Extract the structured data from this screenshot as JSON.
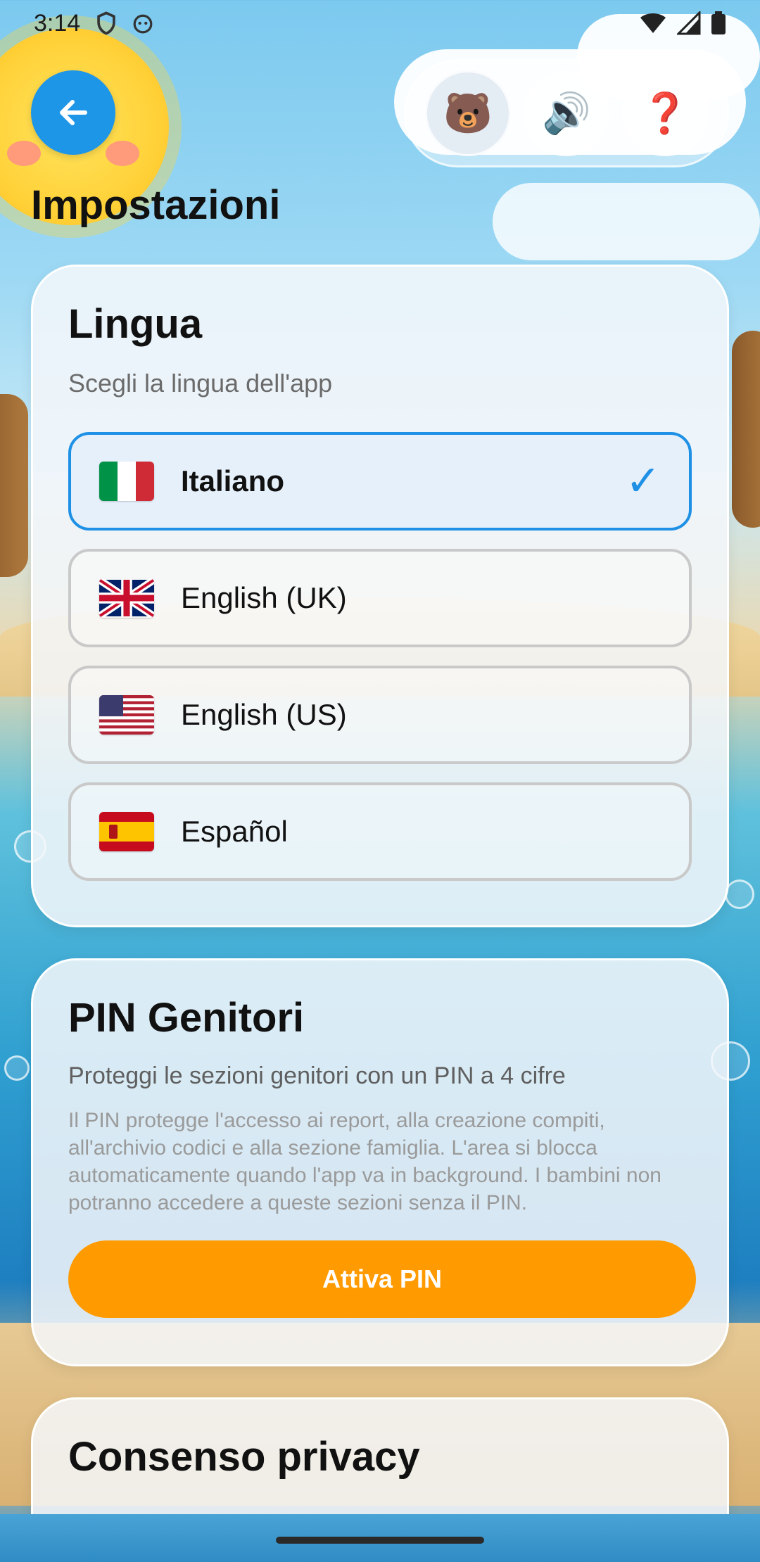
{
  "status_bar": {
    "time": "3:14"
  },
  "header": {
    "back_icon": "arrow-left-icon",
    "pill_buttons": [
      {
        "icon": "bear-icon",
        "glyph": "🐻"
      },
      {
        "icon": "speaker-icon",
        "glyph": "🔊"
      },
      {
        "icon": "question-icon",
        "glyph": "❓"
      }
    ]
  },
  "page": {
    "title": "Impostazioni"
  },
  "language_card": {
    "title": "Lingua",
    "subtitle": "Scegli la lingua dell'app",
    "options": [
      {
        "label": "Italiano",
        "flag": "flag-italy-icon",
        "selected": true
      },
      {
        "label": "English (UK)",
        "flag": "flag-uk-icon",
        "selected": false
      },
      {
        "label": "English (US)",
        "flag": "flag-us-icon",
        "selected": false
      },
      {
        "label": "Español",
        "flag": "flag-spain-icon",
        "selected": false
      }
    ],
    "check_glyph": "✓"
  },
  "pin_card": {
    "title": "PIN Genitori",
    "description": "Proteggi le sezioni genitori con un PIN a 4 cifre",
    "note": "Il PIN protegge l'accesso ai report, alla creazione compiti, all'archivio codici e alla sezione famiglia. L'area si blocca automaticamente quando l'app va in background. I bambini non potranno accedere a queste sezioni senza il PIN.",
    "button_label": "Attiva PIN"
  },
  "privacy_card": {
    "title": "Consenso privacy"
  },
  "colors": {
    "accent_blue": "#1e90e6",
    "pin_orange": "#ff9a00"
  }
}
